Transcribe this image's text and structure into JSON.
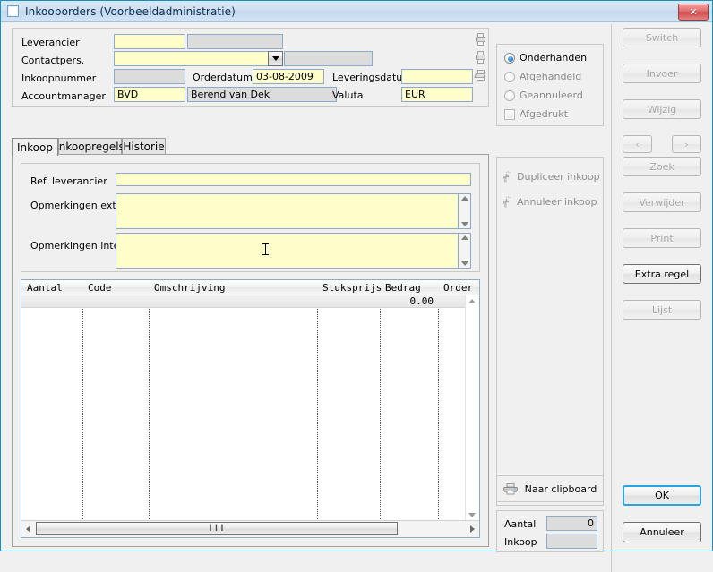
{
  "window": {
    "title": "Inkooporders (Voorbeeldadministratie)",
    "close_label": "✕",
    "accent_color": "#1a8fb5",
    "titlebar_color": "#cfe0f2",
    "field_color": "#ffffcc",
    "readonly_color": "#dcdcdc"
  },
  "header_form": {
    "fields": [
      {
        "label": "Leverancier",
        "value": "",
        "name_value": ""
      },
      {
        "label": "Contactpers.",
        "value": ""
      },
      {
        "label": "Inkoopnummer",
        "value": ""
      },
      {
        "label": "Accountmanager",
        "value": "BVD",
        "name_value": "Berend van Dek"
      }
    ],
    "orderdatum_label": "Orderdatum",
    "orderdatum_value": "03-08-2009",
    "leveringsdatum_label": "Leveringsdatum",
    "leveringsdatum_value": "",
    "valuta_label": "Valuta",
    "valuta_value": "EUR"
  },
  "status_panel": {
    "options": [
      {
        "label": "Onderhanden",
        "selected": true,
        "type": "radio"
      },
      {
        "label": "Afgehandeld",
        "selected": false,
        "type": "radio"
      },
      {
        "label": "Geannuleerd",
        "selected": false,
        "type": "radio"
      },
      {
        "label": "Afgedrukt",
        "selected": false,
        "type": "checkbox"
      }
    ]
  },
  "tabs": [
    {
      "label": "Inkoop",
      "active": true
    },
    {
      "label": "Inkoopregels",
      "active": false
    },
    {
      "label": "Historie",
      "active": false
    }
  ],
  "notes": {
    "ref_label": "Ref. leverancier",
    "ref_value": "",
    "extern_label": "Opmerkingen extern",
    "extern_value": "",
    "intern_label": "Opmerkingen intern",
    "intern_value": ""
  },
  "grid": {
    "columns": [
      {
        "key": "aantal",
        "label": "Aantal"
      },
      {
        "key": "code",
        "label": "Code"
      },
      {
        "key": "omschrijving",
        "label": "Omschrijving"
      },
      {
        "key": "stuksprijs",
        "label": "Stuksprijs"
      },
      {
        "key": "bedrag",
        "label": "Bedrag"
      },
      {
        "key": "order",
        "label": "Order"
      }
    ],
    "rows": [
      {
        "aantal": "",
        "code": "",
        "omschrijving": "",
        "stuksprijs": "",
        "bedrag": "0.00",
        "order": ""
      }
    ],
    "hscroll_grip": "❙❙❙"
  },
  "actions_panel": {
    "duplicate_label": "Dupliceer inkoop",
    "cancel_label": "Annuleer inkoop",
    "clipboard_label": "Naar clipboard"
  },
  "totals": {
    "aantal_label": "Aantal",
    "aantal_value": "0",
    "inkoop_label": "Inkoop",
    "inkoop_value": ""
  },
  "sidebar_buttons": [
    {
      "label": "Switch",
      "state": "disabled"
    },
    {
      "label": "Invoer",
      "state": "disabled"
    },
    {
      "label": "Wijzig",
      "state": "disabled"
    },
    {
      "label": "‹",
      "state": "disabled"
    },
    {
      "label": "›",
      "state": "disabled"
    },
    {
      "label": "Zoek",
      "state": "disabled"
    },
    {
      "label": "Verwijder",
      "state": "disabled"
    },
    {
      "label": "Print",
      "state": "disabled"
    },
    {
      "label": "Extra regel",
      "state": "enabled"
    },
    {
      "label": "Lijst",
      "state": "disabled"
    },
    {
      "label": "OK",
      "state": "default"
    },
    {
      "label": "Annuleer",
      "state": "enabled"
    }
  ]
}
